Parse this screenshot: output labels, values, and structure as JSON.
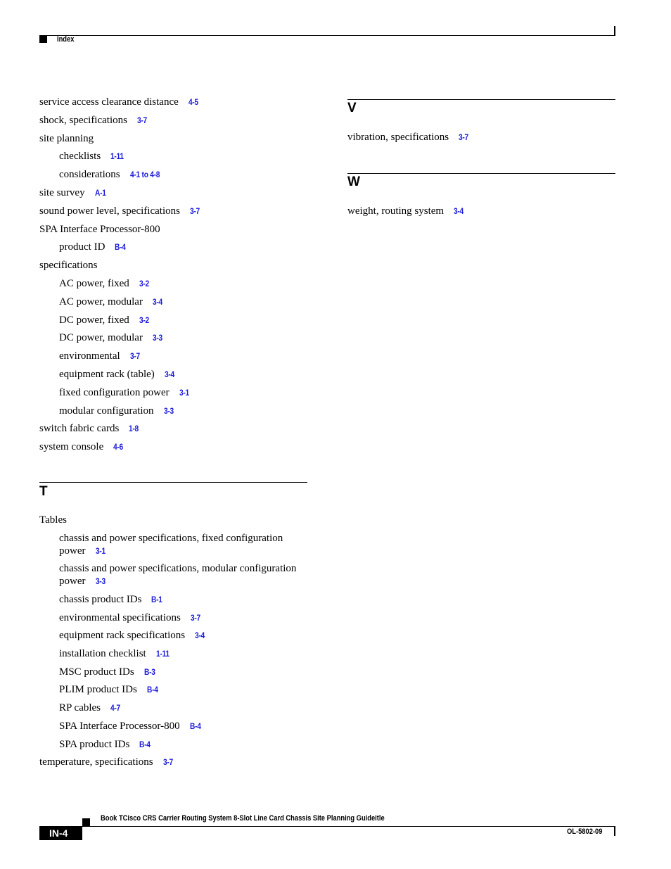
{
  "header": {
    "section_label": "Index"
  },
  "left_column": {
    "entries": [
      {
        "text": "service access clearance distance",
        "ref": "4-5",
        "level": 0
      },
      {
        "text": "shock, specifications",
        "ref": "3-7",
        "level": 0
      },
      {
        "text": "site planning",
        "ref": null,
        "level": 0
      },
      {
        "text": "checklists",
        "ref": "1-11",
        "level": 1
      },
      {
        "text": "considerations",
        "ref": "4-1 to 4-8",
        "level": 1
      },
      {
        "text": "site survey",
        "ref": "A-1",
        "level": 0
      },
      {
        "text": "sound power level, specifications",
        "ref": "3-7",
        "level": 0
      },
      {
        "text": "SPA Interface Processor-800",
        "ref": null,
        "level": 0
      },
      {
        "text": "product ID",
        "ref": "B-4",
        "level": 1
      },
      {
        "text": "specifications",
        "ref": null,
        "level": 0
      },
      {
        "text": "AC power, fixed",
        "ref": "3-2",
        "level": 1
      },
      {
        "text": "AC power, modular",
        "ref": "3-4",
        "level": 1
      },
      {
        "text": "DC power, fixed",
        "ref": "3-2",
        "level": 1
      },
      {
        "text": "DC power, modular",
        "ref": "3-3",
        "level": 1
      },
      {
        "text": "environmental",
        "ref": "3-7",
        "level": 1
      },
      {
        "text": "equipment rack (table)",
        "ref": "3-4",
        "level": 1
      },
      {
        "text": "fixed configuration power",
        "ref": "3-1",
        "level": 1
      },
      {
        "text": "modular configuration",
        "ref": "3-3",
        "level": 1
      },
      {
        "text": "switch fabric cards",
        "ref": "1-8",
        "level": 0
      },
      {
        "text": "system console",
        "ref": "4-6",
        "level": 0
      }
    ],
    "section_t": {
      "letter": "T",
      "entries": [
        {
          "text": "Tables",
          "ref": null,
          "level": 0
        },
        {
          "text": "chassis and power specifications, fixed configuration power",
          "ref": "3-1",
          "level": 1
        },
        {
          "text": "chassis and power specifications, modular configuration power",
          "ref": "3-3",
          "level": 1
        },
        {
          "text": "chassis product IDs",
          "ref": "B-1",
          "level": 1
        },
        {
          "text": "environmental specifications",
          "ref": "3-7",
          "level": 1
        },
        {
          "text": "equipment rack specifications",
          "ref": "3-4",
          "level": 1
        },
        {
          "text": "installation checklist",
          "ref": "1-11",
          "level": 1
        },
        {
          "text": "MSC product IDs",
          "ref": "B-3",
          "level": 1
        },
        {
          "text": "PLIM product IDs",
          "ref": "B-4",
          "level": 1
        },
        {
          "text": "RP cables",
          "ref": "4-7",
          "level": 1
        },
        {
          "text": "SPA Interface Processor-800",
          "ref": "B-4",
          "level": 1
        },
        {
          "text": "SPA product IDs",
          "ref": "B-4",
          "level": 1
        },
        {
          "text": "temperature, specifications",
          "ref": "3-7",
          "level": 0
        }
      ]
    }
  },
  "right_column": {
    "section_v": {
      "letter": "V",
      "entries": [
        {
          "text": "vibration, specifications",
          "ref": "3-7",
          "level": 0
        }
      ]
    },
    "section_w": {
      "letter": "W",
      "entries": [
        {
          "text": "weight, routing system",
          "ref": "3-4",
          "level": 0
        }
      ]
    }
  },
  "footer": {
    "book_title": "Book TCisco CRS Carrier Routing System 8-Slot Line Card Chassis Site Planning Guideitle",
    "page_number": "IN-4",
    "doc_number": "OL-5802-09"
  },
  "colors": {
    "link": "#1a1adb",
    "text": "#000000"
  }
}
